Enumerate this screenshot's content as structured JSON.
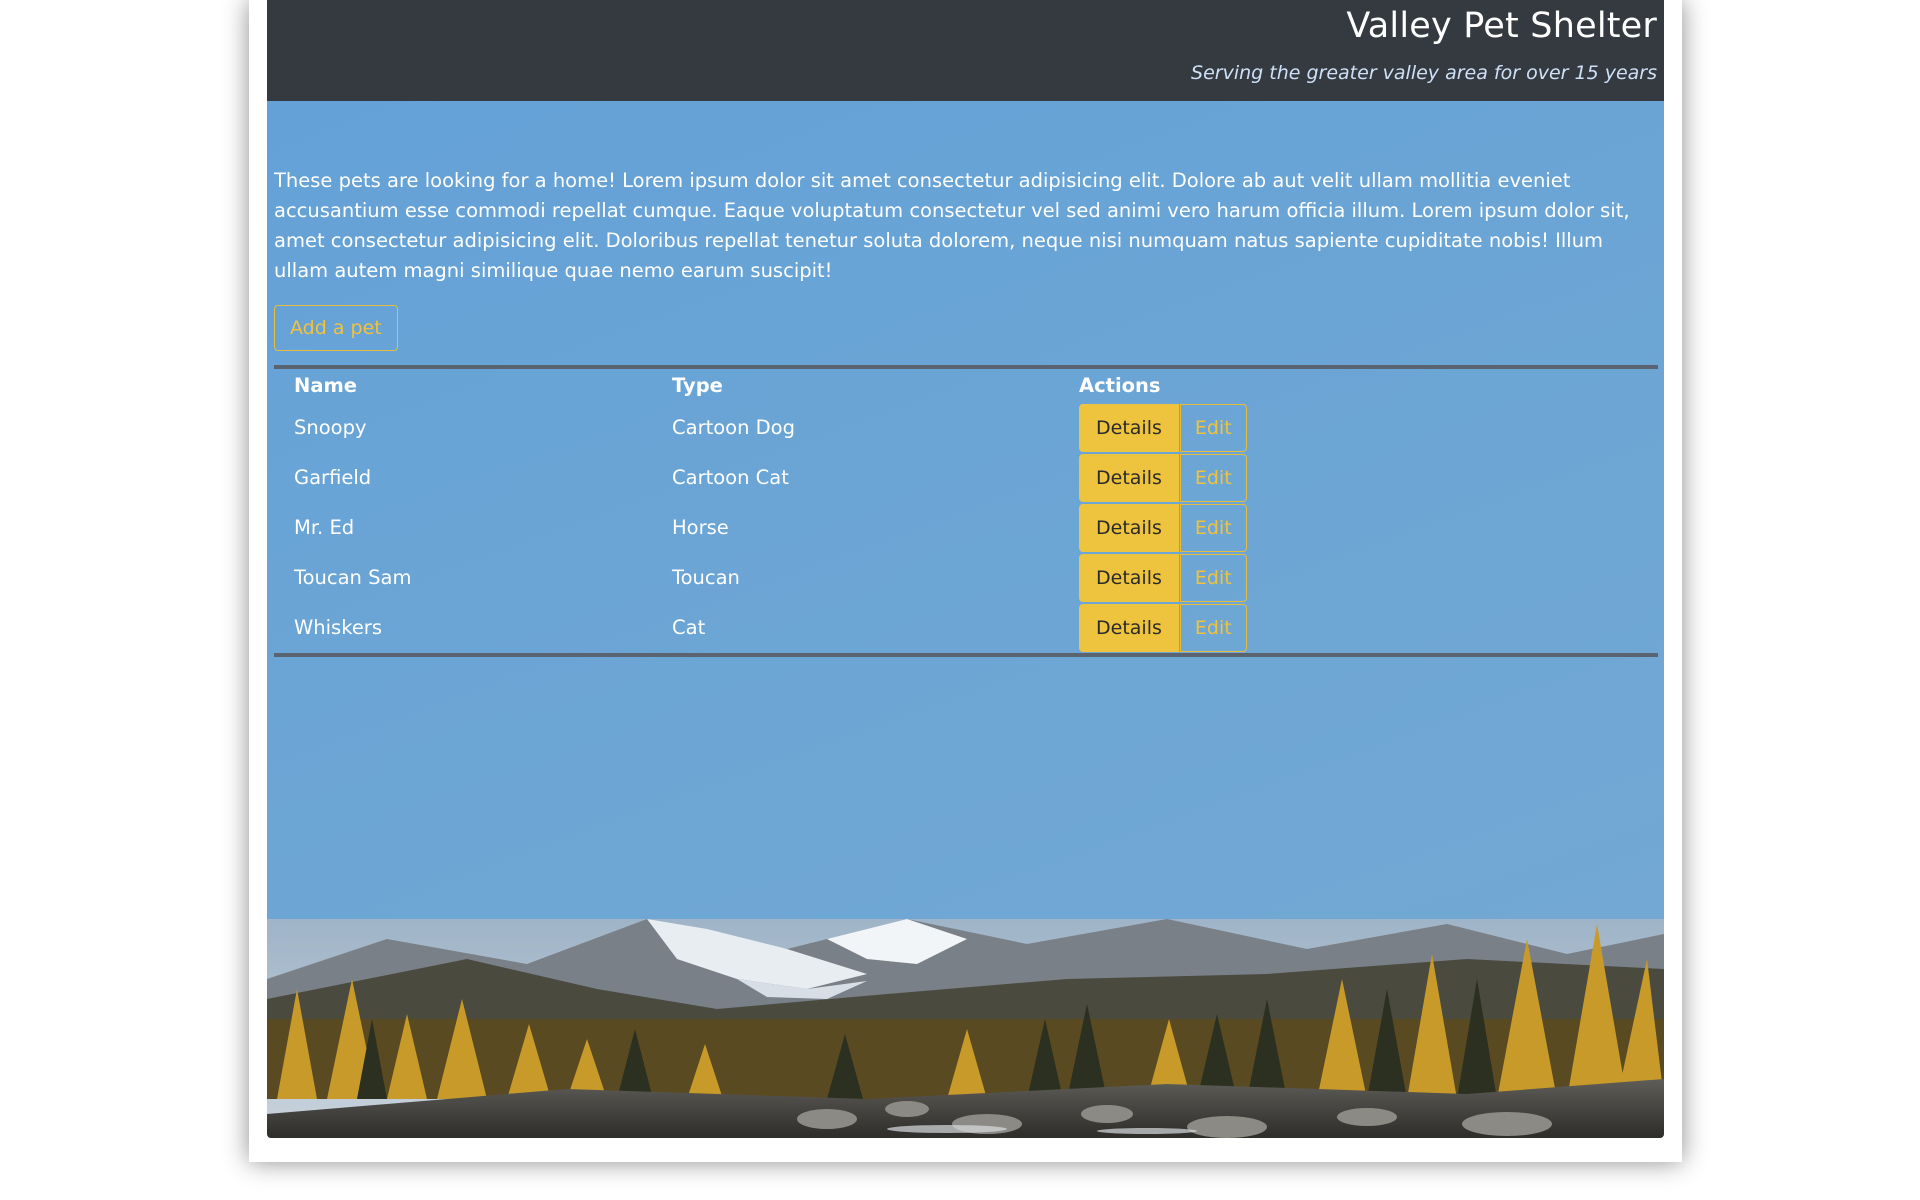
{
  "header": {
    "title": "Valley Pet Shelter",
    "subtitle": "Serving the greater valley area for over 15 years"
  },
  "main": {
    "intro": "These pets are looking for a home! Lorem ipsum dolor sit amet consectetur adipisicing elit. Dolore ab aut velit ullam mollitia eveniet accusantium esse commodi repellat cumque. Eaque voluptatum consectetur vel sed animi vero harum officia illum. Lorem ipsum dolor sit, amet consectetur adipisicing elit. Doloribus repellat tenetur soluta dolorem, neque nisi numquam natus sapiente cupiditate nobis! Illum ullam autem magni similique quae nemo earum suscipit!",
    "add_button": "Add a pet"
  },
  "table": {
    "headers": [
      "Name",
      "Type",
      "Actions"
    ],
    "rows": [
      {
        "name": "Snoopy",
        "type": "Cartoon Dog"
      },
      {
        "name": "Garfield",
        "type": "Cartoon Cat"
      },
      {
        "name": "Mr. Ed",
        "type": "Horse"
      },
      {
        "name": "Toucan Sam",
        "type": "Toucan"
      },
      {
        "name": "Whiskers",
        "type": "Cat"
      }
    ],
    "details_label": "Details",
    "edit_label": "Edit"
  },
  "colors": {
    "header_bg": "#343a40",
    "main_bg": "#67a3d6",
    "accent_yellow": "#eec33d"
  },
  "footer_image": "mountain-forest-river-landscape"
}
